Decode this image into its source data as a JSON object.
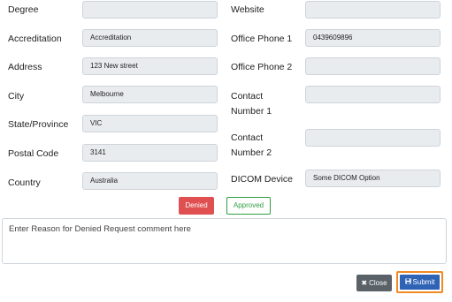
{
  "left_fields": [
    {
      "label": "Degree",
      "value": ""
    },
    {
      "label": "Accreditation",
      "value": "Accreditation"
    },
    {
      "label": "Address",
      "value": "123 New street"
    },
    {
      "label": "City",
      "value": "Melbourne"
    },
    {
      "label": "State/Province",
      "value": "VIC"
    },
    {
      "label": "Postal Code",
      "value": "3141"
    },
    {
      "label": "Country",
      "value": "Australia"
    }
  ],
  "right_fields": [
    {
      "label": "Website",
      "value": ""
    },
    {
      "label": "Office Phone 1",
      "value": "0439609896"
    },
    {
      "label": "Office Phone 2",
      "value": ""
    },
    {
      "label_line1": "Contact",
      "label_line2": "Number 1",
      "value": ""
    },
    {
      "label_line1": "Contact",
      "label_line2": "Number 2",
      "value": ""
    },
    {
      "label": "DICOM Device",
      "value": "Some DICOM Option"
    }
  ],
  "status_buttons": {
    "denied": "Denied",
    "approved": "Approved"
  },
  "comment": {
    "placeholder": "Enter Reason for Denied Request comment here"
  },
  "actions": {
    "close_icon": "✖",
    "close": "Close",
    "submit_icon": "💾",
    "submit": "Submit"
  },
  "colors": {
    "denied": "#e05050",
    "approved": "#2e9e44",
    "submit": "#2f63b5",
    "submit_focus": "#f08a24",
    "close": "#5a6268"
  }
}
